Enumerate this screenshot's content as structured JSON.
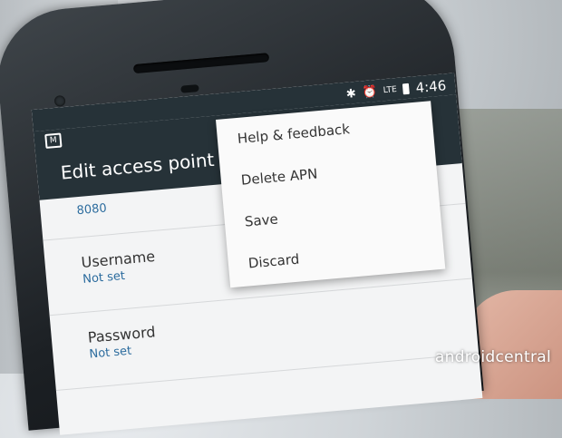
{
  "status_bar": {
    "time": "4:46",
    "icons": [
      "bluetooth-icon",
      "alarm-icon",
      "lte-signal-icon",
      "battery-icon"
    ],
    "lte_label": "LTE"
  },
  "app_bar": {
    "title": "Edit access point",
    "app_icon": "mail-icon"
  },
  "list": {
    "port_value": "8080",
    "items": [
      {
        "title": "Username",
        "value": "Not set"
      },
      {
        "title": "Password",
        "value": "Not set"
      }
    ]
  },
  "menu": {
    "items": [
      "Help & feedback",
      "Delete APN",
      "Save",
      "Discard"
    ]
  },
  "watermark": "androidcentral",
  "colors": {
    "appbar": "#263238",
    "accent_text": "#2c6c9e",
    "screen_bg": "#f3f4f5"
  }
}
